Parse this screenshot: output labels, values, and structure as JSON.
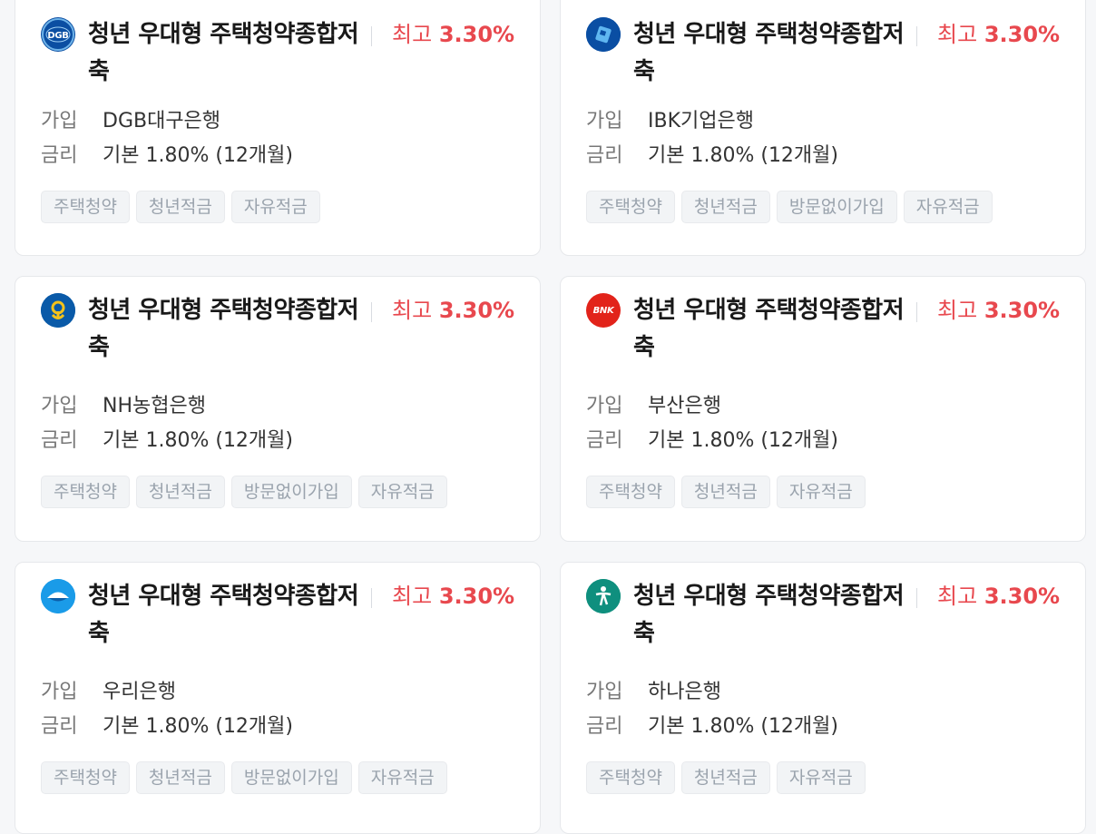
{
  "labels": {
    "join": "가입",
    "rate": "금리"
  },
  "cards": [
    {
      "title": "청년 우대형 주택청약종합저축",
      "max_rate_prefix": "최고",
      "max_rate": "3.30%",
      "bank": "DGB대구은행",
      "base_rate": "기본 1.80% (12개월)",
      "logo_icon": "dgb-bank-logo",
      "logo_text": "DGB",
      "logo_color": "#0b4ea2",
      "tags": [
        "주택청약",
        "청년적금",
        "자유적금"
      ]
    },
    {
      "title": "청년 우대형 주택청약종합저축",
      "max_rate_prefix": "최고",
      "max_rate": "3.30%",
      "bank": "IBK기업은행",
      "base_rate": "기본 1.80% (12개월)",
      "logo_icon": "ibk-bank-logo",
      "logo_text": "",
      "logo_color": "#0a4ea3",
      "tags": [
        "주택청약",
        "청년적금",
        "방문없이가입",
        "자유적금"
      ]
    },
    {
      "title": "청년 우대형 주택청약종합저축",
      "max_rate_prefix": "최고",
      "max_rate": "3.30%",
      "bank": "NH농협은행",
      "base_rate": "기본 1.80% (12개월)",
      "logo_icon": "nh-bank-logo",
      "logo_text": "",
      "logo_color": "#0a5aa8",
      "tags": [
        "주택청약",
        "청년적금",
        "방문없이가입",
        "자유적금"
      ]
    },
    {
      "title": "청년 우대형 주택청약종합저축",
      "max_rate_prefix": "최고",
      "max_rate": "3.30%",
      "bank": "부산은행",
      "base_rate": "기본 1.80% (12개월)",
      "logo_icon": "bnk-bank-logo",
      "logo_text": "BNK",
      "logo_color": "#e2231a",
      "tags": [
        "주택청약",
        "청년적금",
        "자유적금"
      ]
    },
    {
      "title": "청년 우대형 주택청약종합저축",
      "max_rate_prefix": "최고",
      "max_rate": "3.30%",
      "bank": "우리은행",
      "base_rate": "기본 1.80% (12개월)",
      "logo_icon": "woori-bank-logo",
      "logo_text": "",
      "logo_color": "#1a9be8",
      "tags": [
        "주택청약",
        "청년적금",
        "방문없이가입",
        "자유적금"
      ]
    },
    {
      "title": "청년 우대형 주택청약종합저축",
      "max_rate_prefix": "최고",
      "max_rate": "3.30%",
      "bank": "하나은행",
      "base_rate": "기본 1.80% (12개월)",
      "logo_icon": "hana-bank-logo",
      "logo_text": "",
      "logo_color": "#0f8f7e",
      "tags": [
        "주택청약",
        "청년적금",
        "자유적금"
      ]
    }
  ]
}
